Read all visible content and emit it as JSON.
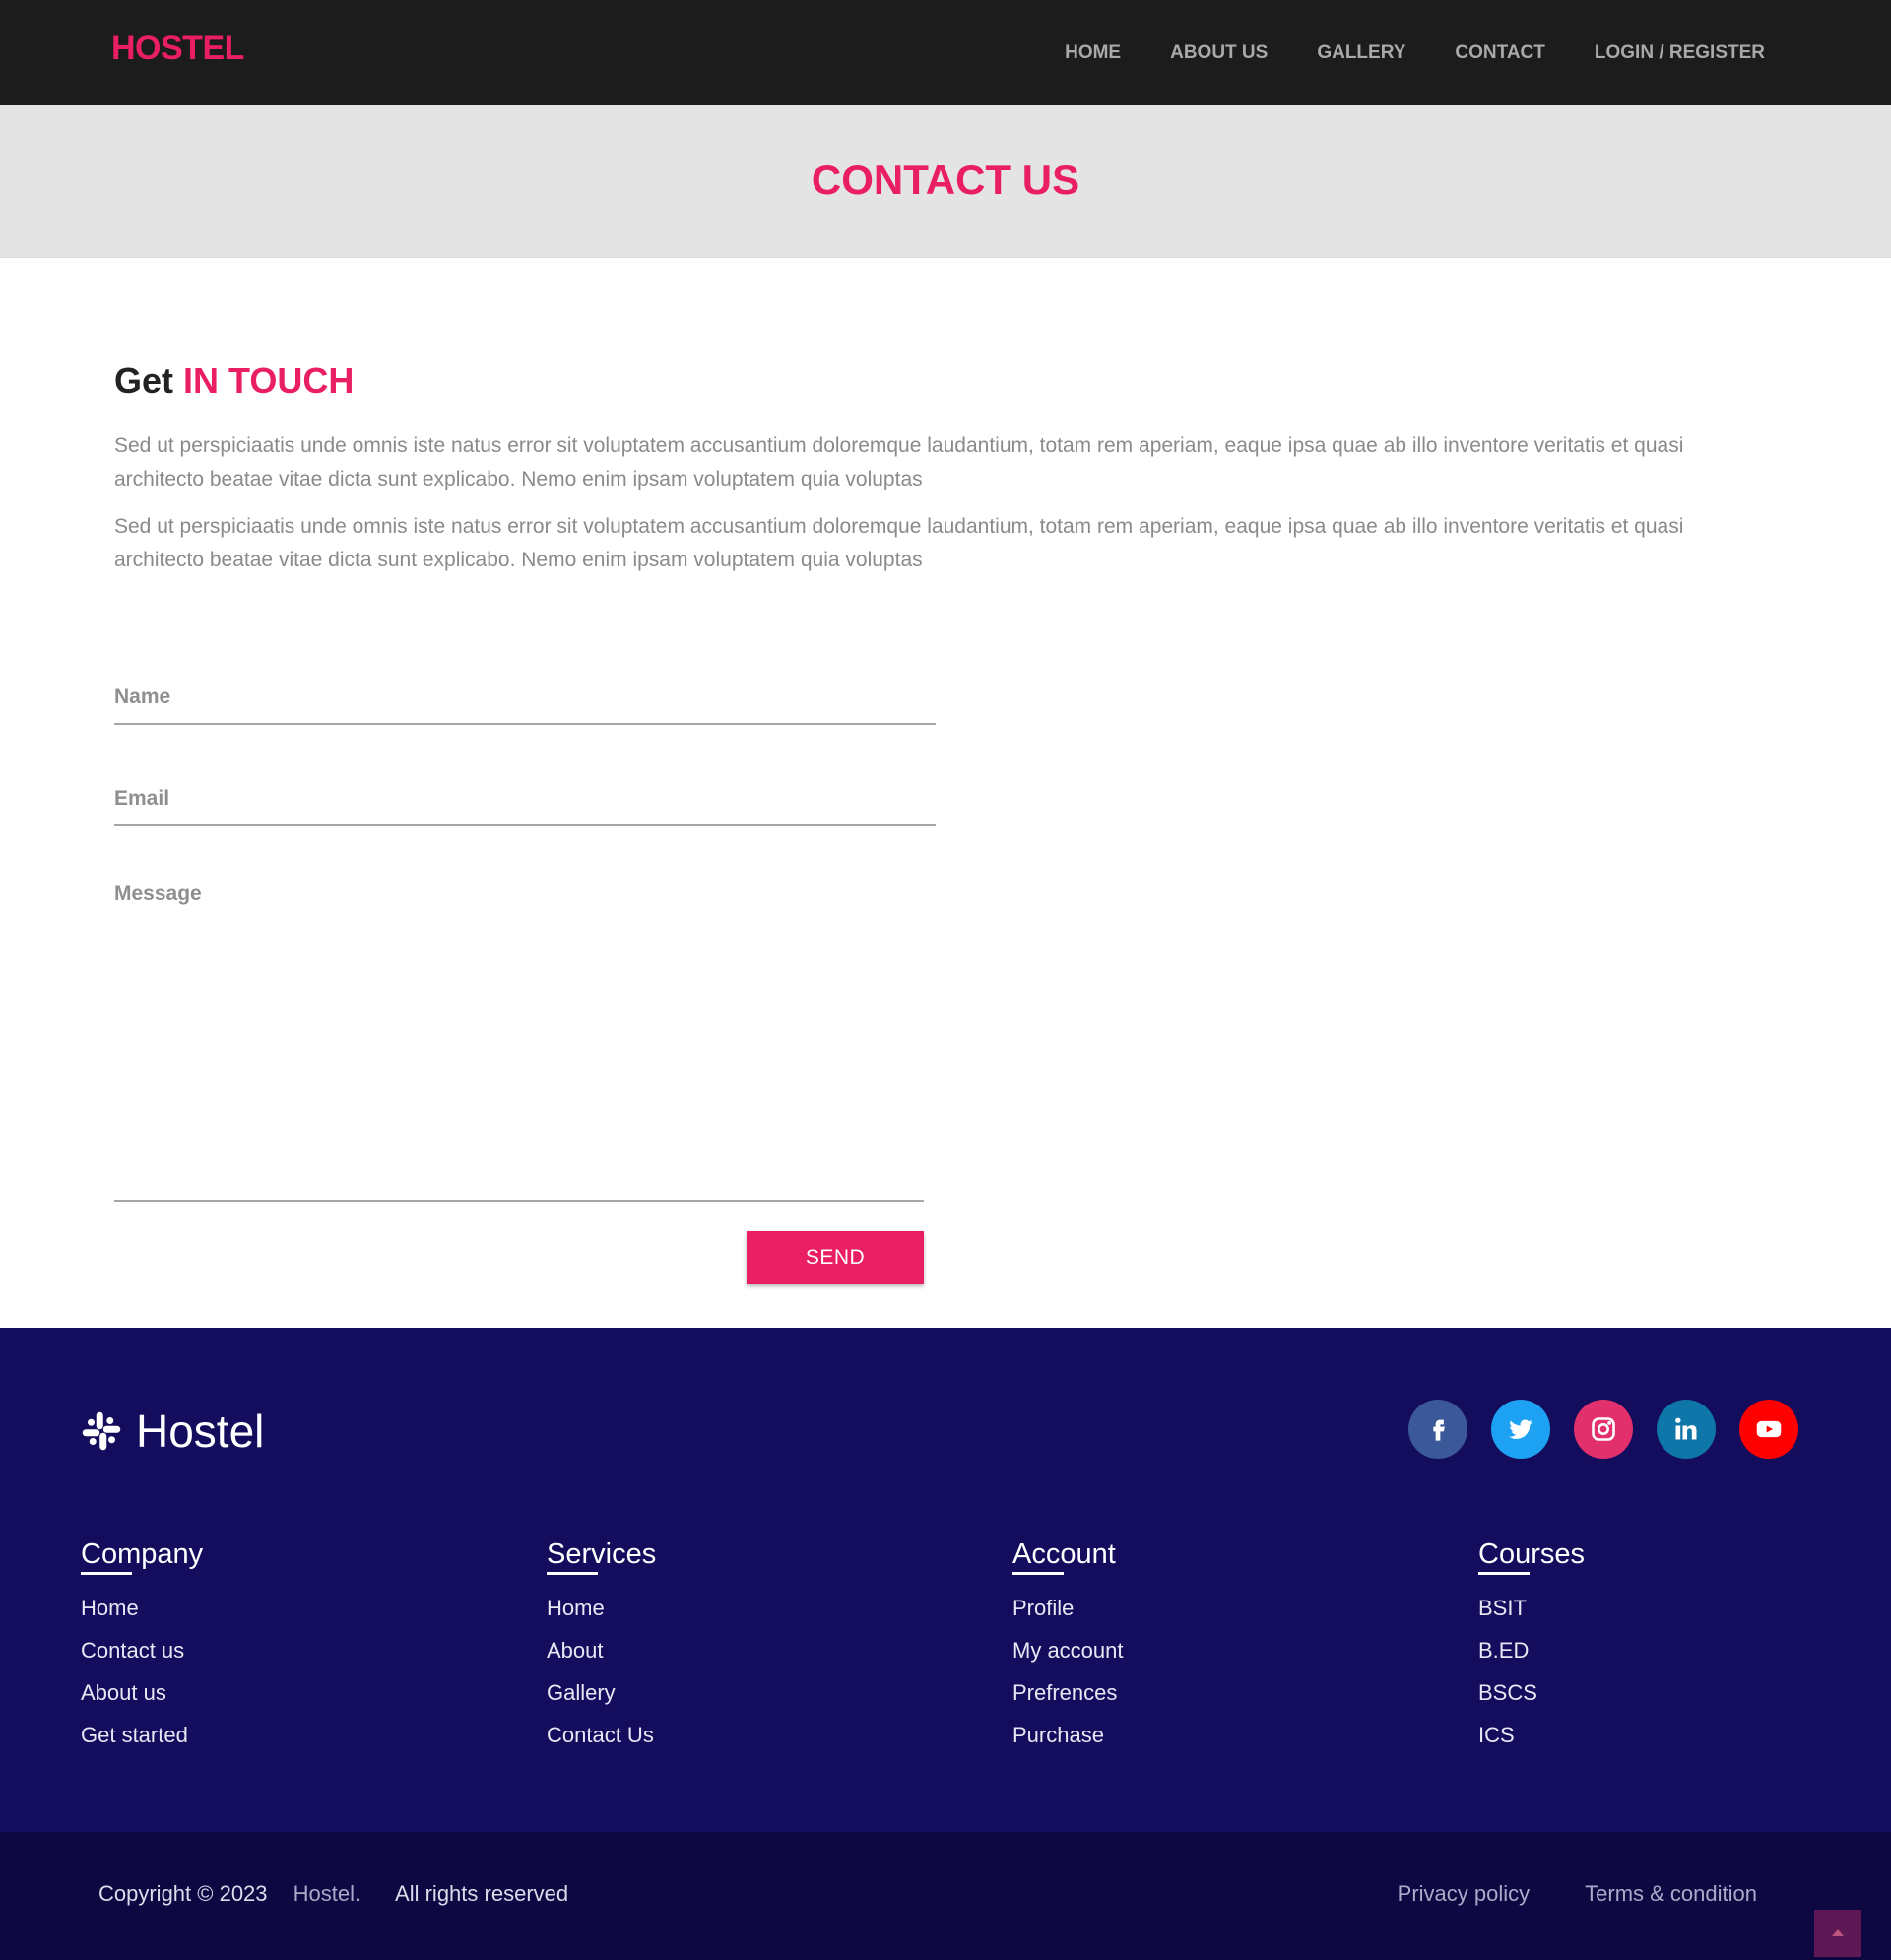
{
  "nav": {
    "brand": "HOSTEL",
    "links": [
      "HOME",
      "ABOUT US",
      "GALLERY",
      "CONTACT",
      "LOGIN / REGISTER"
    ]
  },
  "header": {
    "title": "CONTACT US"
  },
  "intro": {
    "heading_plain": "Get",
    "heading_accent": "IN TOUCH",
    "paragraphs": [
      "Sed ut perspiciaatis unde omnis iste natus error sit voluptatem accusantium doloremque laudantium, totam rem aperiam, eaque ipsa quae ab illo inventore veritatis et quasi architecto beatae vitae dicta sunt explicabo. Nemo enim ipsam voluptatem quia voluptas",
      "Sed ut perspiciaatis unde omnis iste natus error sit voluptatem accusantium doloremque laudantium, totam rem aperiam, eaque ipsa quae ab illo inventore veritatis et quasi architecto beatae vitae dicta sunt explicabo. Nemo enim ipsam voluptatem quia voluptas"
    ]
  },
  "form": {
    "name_placeholder": "Name",
    "email_placeholder": "Email",
    "message_placeholder": "Message",
    "send_label": "SEND"
  },
  "footer": {
    "logo_text": "Hostel",
    "logo_icon": "slack-icon",
    "socials": [
      {
        "name": "facebook-icon",
        "color": "#3b5998"
      },
      {
        "name": "twitter-icon",
        "color": "#1da1f2"
      },
      {
        "name": "instagram-icon",
        "color": "#e1306c"
      },
      {
        "name": "linkedin-icon",
        "color": "#0e76a8"
      },
      {
        "name": "youtube-icon",
        "color": "#ff0000"
      }
    ],
    "columns": [
      {
        "title": "Company",
        "items": [
          "Home",
          "Contact us",
          "About us",
          "Get started"
        ]
      },
      {
        "title": "Services",
        "items": [
          "Home",
          "About",
          "Gallery",
          "Contact Us"
        ]
      },
      {
        "title": "Account",
        "items": [
          "Profile",
          "My account",
          "Prefrences",
          "Purchase"
        ]
      },
      {
        "title": "Courses",
        "items": [
          "BSIT",
          "B.ED",
          "BSCS",
          "ICS"
        ]
      }
    ]
  },
  "bottom": {
    "copyright": "Copyright © 2023",
    "brand": "Hostel.",
    "rights": "All rights reserved",
    "privacy": "Privacy policy",
    "terms": "Terms & condition",
    "to_top_icon": "chevron-up-icon"
  },
  "colors": {
    "accent": "#e91e63",
    "navbar": "#1c1c1c",
    "footer": "#140c5c",
    "bottombar": "#0e0842"
  }
}
